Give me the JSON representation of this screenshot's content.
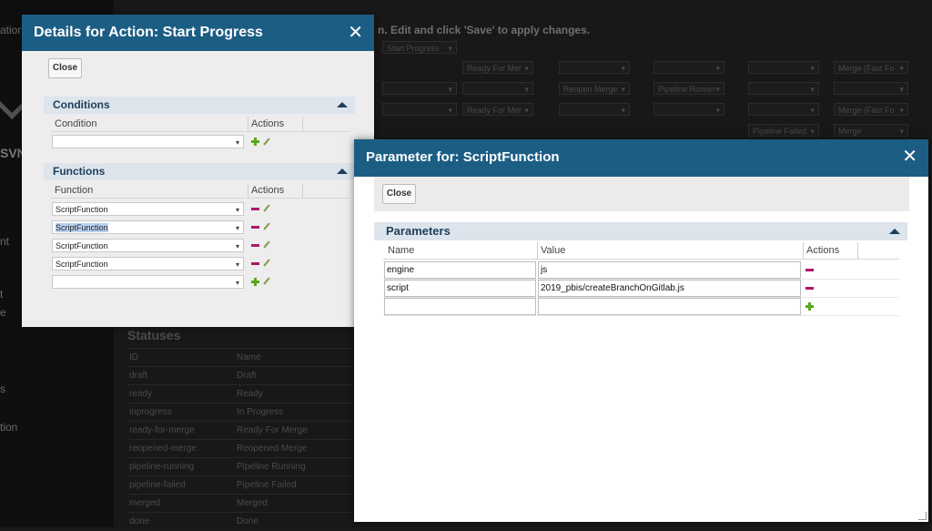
{
  "background": {
    "sidebar_items": [
      "ation",
      "SVN",
      "nt",
      "t",
      "e",
      "s",
      "tion"
    ],
    "instruction_text": "n. Edit and click 'Save' to apply changes.",
    "selects": [
      "Start Progress",
      "Ready For Mer",
      "Merge (Fast Fo",
      "Reopen Merge",
      "Pipeline Runnin",
      "Ready For Mer",
      "Merge (Fast Fo",
      "Pipeline Failed",
      "Merge"
    ],
    "statuses_title": "Statuses",
    "statuses": [
      {
        "id": "ID",
        "name": "Name"
      },
      {
        "id": "draft",
        "name": "Draft"
      },
      {
        "id": "ready",
        "name": "Ready"
      },
      {
        "id": "inprogress",
        "name": "In Progress"
      },
      {
        "id": "ready-for-merge",
        "name": "Ready For Merge"
      },
      {
        "id": "reopened-merge",
        "name": "Reopened Merge"
      },
      {
        "id": "pipeline-running",
        "name": "Pipeline Running"
      },
      {
        "id": "pipeline-failed",
        "name": "Pipeline Failed"
      },
      {
        "id": "merged",
        "name": "Merged"
      },
      {
        "id": "done",
        "name": "Done"
      }
    ]
  },
  "action_dialog": {
    "title": "Details for Action: Start Progress",
    "close_label": "Close",
    "conditions": {
      "title": "Conditions",
      "col_condition": "Condition",
      "col_actions": "Actions",
      "rows": [
        ""
      ]
    },
    "functions": {
      "title": "Functions",
      "col_function": "Function",
      "col_actions": "Actions",
      "rows": [
        "ScriptFunction",
        "ScriptFunction",
        "ScriptFunction",
        "ScriptFunction",
        ""
      ]
    }
  },
  "param_dialog": {
    "title": "Parameter for: ScriptFunction",
    "close_label": "Close",
    "section_title": "Parameters",
    "col_name": "Name",
    "col_value": "Value",
    "col_actions": "Actions",
    "rows": [
      {
        "name": "engine",
        "value": "js"
      },
      {
        "name": "script",
        "value": "2019_pbis/createBranchOnGitlab.js"
      },
      {
        "name": "",
        "value": ""
      }
    ]
  },
  "colors": {
    "titlebar": "#1c5d84",
    "remove": "#b0166a",
    "add": "#5aa61e"
  }
}
